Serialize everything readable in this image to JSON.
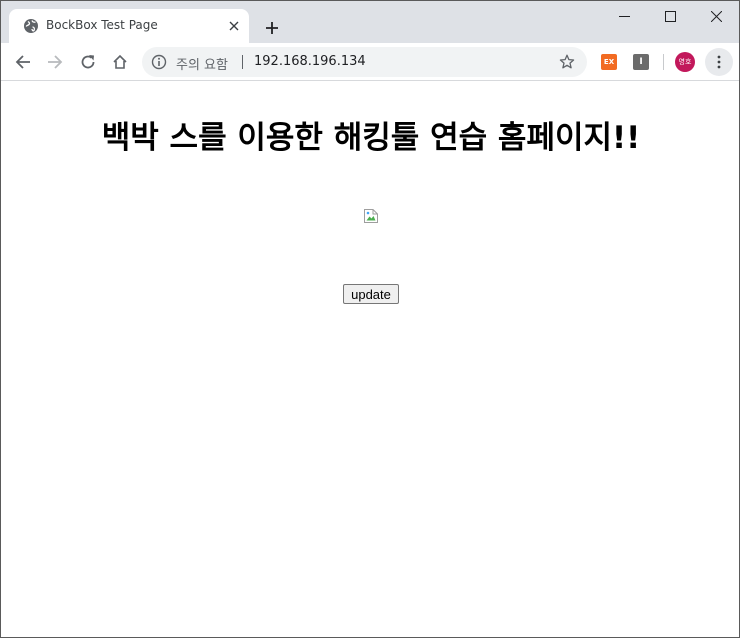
{
  "browser": {
    "tab": {
      "title": "BockBox Test Page",
      "favicon": "globe-icon"
    },
    "new_tab_icon": "plus-icon",
    "window_controls": [
      "minimize-icon",
      "maximize-icon",
      "close-icon"
    ],
    "nav": [
      "back-arrow-icon",
      "forward-arrow-icon",
      "reload-icon",
      "home-icon"
    ],
    "omnibox": {
      "security_icon": "info-icon",
      "security_text": "주의 요함",
      "url": "192.168.196.134",
      "bookmark_icon": "star-icon"
    },
    "extensions": [
      {
        "name": "ex-extension-icon",
        "label": "EX",
        "color": "#f26b22"
      },
      {
        "name": "i-extension-icon",
        "label": "I",
        "color": "#6b6b6b"
      }
    ],
    "profile": {
      "label": "영호",
      "color": "#c2185b"
    },
    "menu_icon": "three-dot-menu-icon"
  },
  "page": {
    "heading": "백박 스를 이용한 해킹툴 연습 홈페이지!!",
    "image_icon": "broken-image-icon",
    "update_button": "update"
  }
}
